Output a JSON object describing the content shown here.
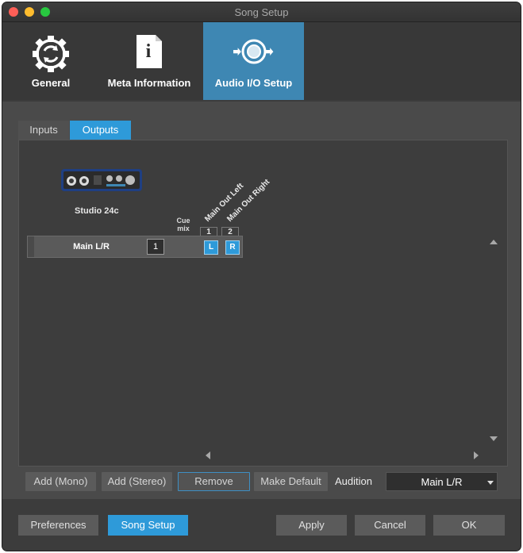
{
  "window": {
    "title": "Song Setup"
  },
  "categories": [
    {
      "label": "General",
      "icon": "gear-icon"
    },
    {
      "label": "Meta Information",
      "icon": "info-document-icon"
    },
    {
      "label": "Audio I/O Setup",
      "icon": "speaker-icon"
    }
  ],
  "tabs": {
    "inputs": "Inputs",
    "outputs": "Outputs"
  },
  "device": {
    "name": "Studio 24c"
  },
  "matrix": {
    "cue_label": "Cue mix",
    "channels": [
      {
        "name": "Main Out Left",
        "number": "1"
      },
      {
        "name": "Main Out Right",
        "number": "2"
      }
    ],
    "rows": [
      {
        "name": "Main L/R",
        "cue": "1",
        "left": "L",
        "right": "R"
      }
    ]
  },
  "actions": {
    "add_mono": "Add (Mono)",
    "add_stereo": "Add (Stereo)",
    "remove": "Remove",
    "make_default": "Make Default",
    "audition_label": "Audition",
    "audition_value": "Main L/R"
  },
  "footer": {
    "preferences": "Preferences",
    "song_setup": "Song Setup",
    "apply": "Apply",
    "cancel": "Cancel",
    "ok": "OK"
  },
  "colors": {
    "accent": "#2e9ad9",
    "selected_category": "#3e87b3",
    "background": "#4a4a4a"
  }
}
